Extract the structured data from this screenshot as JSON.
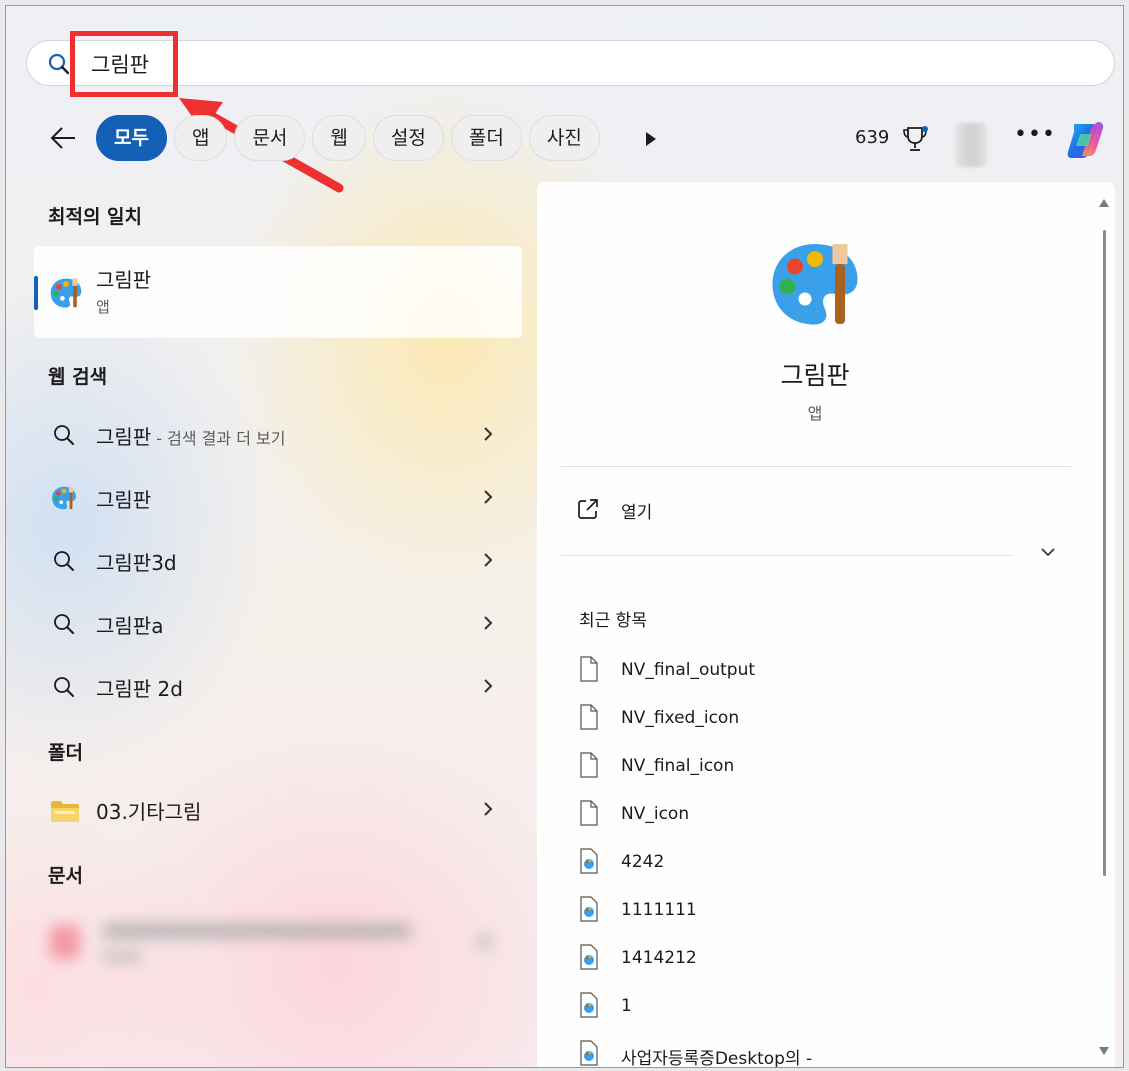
{
  "search": {
    "query": "그림판"
  },
  "filters": {
    "chips": [
      {
        "label": "모두",
        "active": true
      },
      {
        "label": "앱",
        "active": false
      },
      {
        "label": "문서",
        "active": false
      },
      {
        "label": "웹",
        "active": false
      },
      {
        "label": "설정",
        "active": false
      },
      {
        "label": "폴더",
        "active": false
      },
      {
        "label": "사진",
        "active": false
      }
    ],
    "points": "639"
  },
  "sections": {
    "best_match": "최적의 일치",
    "web_search": "웹 검색",
    "folders": "폴더",
    "documents": "문서"
  },
  "best_match": {
    "title": "그림판",
    "type": "앱"
  },
  "web_results": [
    {
      "label": "그림판",
      "sub": " - 검색 결과 더 보기",
      "icon": "search-icon"
    },
    {
      "label": "그림판",
      "sub": "",
      "icon": "paint-app-icon"
    },
    {
      "label": "그림판3d",
      "sub": "",
      "icon": "search-icon"
    },
    {
      "label": "그림판a",
      "sub": "",
      "icon": "search-icon"
    },
    {
      "label": "그림판 2d",
      "sub": "",
      "icon": "search-icon"
    }
  ],
  "folder_results": [
    {
      "label": "03.기타그림",
      "icon": "folder-icon"
    }
  ],
  "preview": {
    "title": "그림판",
    "type": "앱",
    "open_label": "열기",
    "recent_heading": "최근 항목",
    "recent_files": [
      {
        "name": "NV_final_output",
        "icon": "blank-file-icon"
      },
      {
        "name": "NV_fixed_icon",
        "icon": "blank-file-icon"
      },
      {
        "name": "NV_final_icon",
        "icon": "blank-file-icon"
      },
      {
        "name": "NV_icon",
        "icon": "blank-file-icon"
      },
      {
        "name": "4242",
        "icon": "image-file-icon"
      },
      {
        "name": "1111111",
        "icon": "image-file-icon"
      },
      {
        "name": "1414212",
        "icon": "image-file-icon"
      },
      {
        "name": "1",
        "icon": "image-file-icon"
      },
      {
        "name": "사업자등록증Desktop의 -",
        "icon": "image-file-icon"
      }
    ]
  },
  "colors": {
    "accent": "#1460b6",
    "annotation": "#ee3030"
  }
}
